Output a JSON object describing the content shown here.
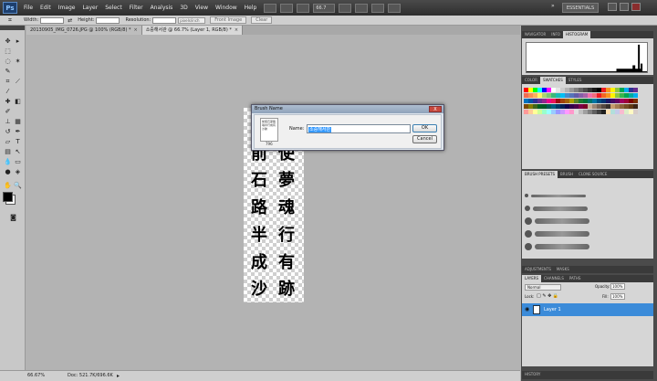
{
  "app": {
    "logo_text": "Ps",
    "menus": [
      "File",
      "Edit",
      "Image",
      "Layer",
      "Select",
      "Filter",
      "Analysis",
      "3D",
      "View",
      "Window",
      "Help"
    ],
    "zoom_level": "66.7",
    "workspace_button": "ESSENTIALS"
  },
  "options_bar": {
    "width_label": "Width:",
    "height_label": "Height:",
    "resolution_label": "Resolution:",
    "resolution_unit": "pixels/inch",
    "front_image_button": "Front Image",
    "clear_button": "Clear"
  },
  "doc_tabs": [
    {
      "label": "20130905_IMG_0726.JPG @ 100% (RGB/8) *",
      "active": false
    },
    {
      "label": "소중해서관 @ 66.7% (Layer 1, RGB/8) *",
      "active": true
    }
  ],
  "canvas": {
    "left_column": [
      "前",
      "石",
      "路",
      "半",
      "成",
      "沙"
    ],
    "right_column": [
      "使",
      "夢",
      "魂",
      "行",
      "有",
      "跡"
    ]
  },
  "dialog": {
    "title": "Brush Name",
    "close_label": "X",
    "thumb_text": "前使石夢路魂半行成有沙跡",
    "thumb_number": "796",
    "name_label": "Name:",
    "name_value": "소중해서관",
    "ok_label": "OK",
    "cancel_label": "Cancel"
  },
  "status_bar": {
    "zoom": "66.67%",
    "doc_info": "Doc: 521.7K/696.6K"
  },
  "panels": {
    "top_tabs": [
      "NAVIGATOR",
      "INFO",
      "HISTOGRAM"
    ],
    "active_top_tab": "HISTOGRAM",
    "color_tabs": [
      "COLOR",
      "SWATCHES",
      "STYLES"
    ],
    "active_color_tab": "SWATCHES",
    "brush_tabs": [
      "BRUSH PRESETS",
      "BRUSH",
      "CLONE SOURCE"
    ],
    "active_brush_tab": "BRUSH PRESETS",
    "adj_tabs": [
      "ADJUSTMENTS",
      "MASKS"
    ],
    "layer_tabs": [
      "LAYERS",
      "CHANNELS",
      "PATHS"
    ],
    "active_layer_tab": "LAYERS",
    "blend_mode": "Normal",
    "opacity_label": "Opacity:",
    "opacity_value": "100%",
    "lock_label": "Lock:",
    "fill_label": "Fill:",
    "fill_value": "100%",
    "layer_name": "Layer 1",
    "history_tab": "HISTORY"
  }
}
